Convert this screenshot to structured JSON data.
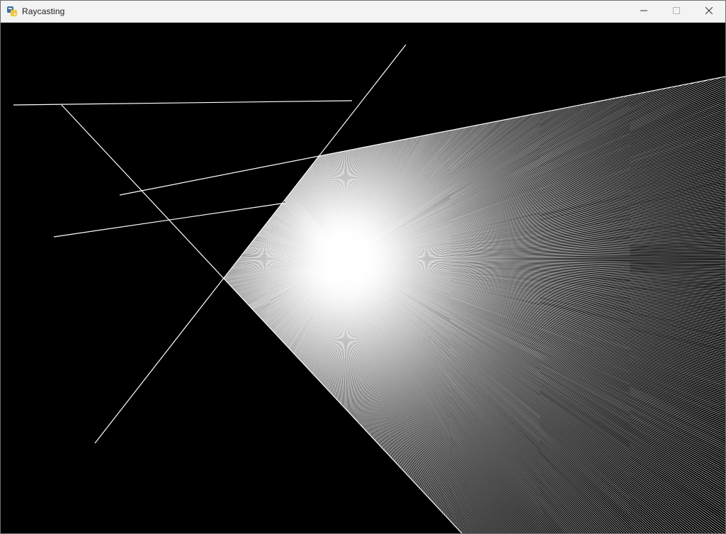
{
  "window": {
    "title": "Raycasting",
    "controls": {
      "minimize_icon": "minimize-icon",
      "maximize_icon": "maximize-icon",
      "close_icon": "close-icon"
    }
  },
  "scene": {
    "background_color": "#000000",
    "wall_color": "#ffffff",
    "ray_color": "#ffffff",
    "icon": "python-app-icon"
  }
}
